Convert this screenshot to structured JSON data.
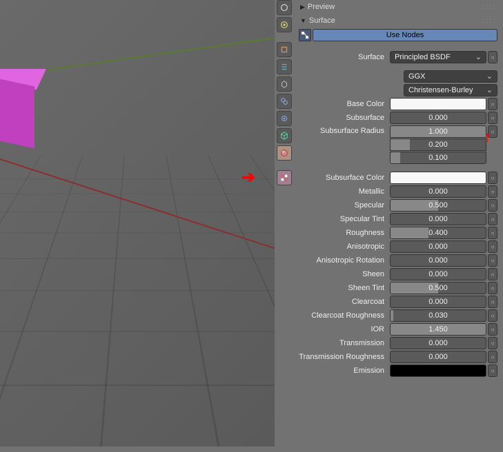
{
  "panels": {
    "preview": {
      "label": "Preview"
    },
    "surface": {
      "label": "Surface"
    }
  },
  "nodes": {
    "use_nodes_label": "Use Nodes"
  },
  "props": {
    "surface": {
      "label": "Surface",
      "value": "Principled BSDF"
    },
    "distribution": {
      "value": "GGX"
    },
    "sss_method": {
      "value": "Christensen-Burley"
    },
    "base_color": {
      "label": "Base Color",
      "value": "#f8f8f8"
    },
    "subsurface": {
      "label": "Subsurface",
      "value": "0.000"
    },
    "subsurface_radius": {
      "label": "Subsurface Radius",
      "r": "1.000",
      "g": "0.200",
      "b": "0.100"
    },
    "subsurface_color": {
      "label": "Subsurface Color",
      "value": "#f8f8f8"
    },
    "metallic": {
      "label": "Metallic",
      "value": "0.000"
    },
    "specular": {
      "label": "Specular",
      "value": "0.500",
      "fill": 50
    },
    "specular_tint": {
      "label": "Specular Tint",
      "value": "0.000"
    },
    "roughness": {
      "label": "Roughness",
      "value": "0.400",
      "fill": 40
    },
    "anisotropic": {
      "label": "Anisotropic",
      "value": "0.000"
    },
    "anisotropic_rotation": {
      "label": "Anisotropic Rotation",
      "value": "0.000"
    },
    "sheen": {
      "label": "Sheen",
      "value": "0.000"
    },
    "sheen_tint": {
      "label": "Sheen Tint",
      "value": "0.500",
      "fill": 50
    },
    "clearcoat": {
      "label": "Clearcoat",
      "value": "0.000"
    },
    "clearcoat_roughness": {
      "label": "Clearcoat Roughness",
      "value": "0.030",
      "fill": 3
    },
    "ior": {
      "label": "IOR",
      "value": "1.450"
    },
    "transmission": {
      "label": "Transmission",
      "value": "0.000"
    },
    "transmission_roughness": {
      "label": "Transmission Roughness",
      "value": "0.000"
    },
    "emission": {
      "label": "Emission",
      "value": "#000000"
    }
  },
  "tabs": [
    {
      "name": "render-tab"
    },
    {
      "name": "render-layers-tab"
    },
    {
      "name": "scene-tab"
    },
    {
      "name": "world-tab"
    },
    {
      "name": "object-tab"
    },
    {
      "name": "constraints-tab"
    },
    {
      "name": "modifiers-tab"
    },
    {
      "name": "data-tab"
    },
    {
      "name": "material-tab"
    },
    {
      "name": "texture-tab"
    }
  ],
  "colors": {
    "accent": "#6787b9",
    "arrow": "#ff0000",
    "cube": "#c040c0"
  }
}
